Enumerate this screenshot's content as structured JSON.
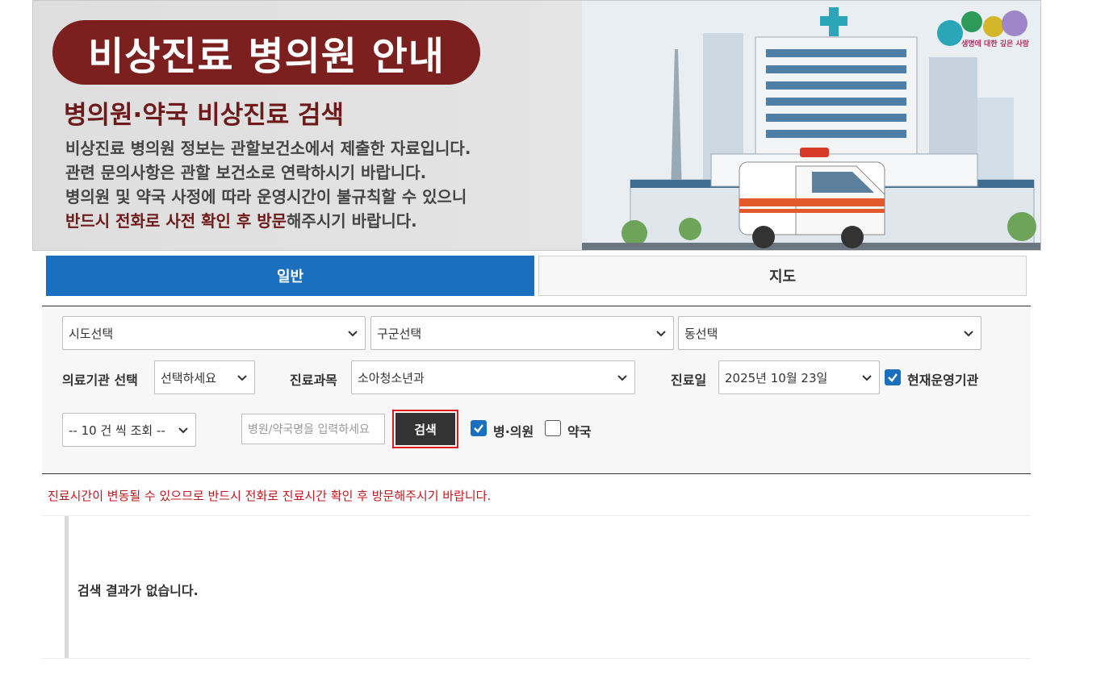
{
  "banner": {
    "title": "비상진료 병의원 안내",
    "subtitle": "병의원·약국 비상진료 검색",
    "lines": [
      "비상진료 병의원 정보는 관할보건소에서 제출한 자료입니다.",
      "관련 문의사항은 관할 보건소로 연락하시기 바랍니다.",
      "병의원 및 약국 사정에 따라 운영시간이 불규칙할 수 있으니"
    ],
    "last_line_emphasis": "반드시 전화로 사전 확인 후 방문",
    "last_line_rest": "해주시기 바랍니다.",
    "logo_caption": "생명에 대한 깊은 사랑",
    "colors": {
      "title_bg": "#7b1f1f",
      "accent_text": "#6e1a1a"
    }
  },
  "tabs": [
    {
      "label": "일반",
      "active": true
    },
    {
      "label": "지도",
      "active": false
    }
  ],
  "filters": {
    "sido": "시도선택",
    "gugun": "구군선택",
    "dong": "동선택",
    "institution_label": "의료기관 선택",
    "institution_value": "선택하세요",
    "department_label": "진료과목",
    "department_value": "소아청소년과",
    "date_label": "진료일",
    "date_value": "2025년 10월 23일",
    "operating_now_label": "현재운영기관",
    "operating_now_checked": true,
    "page_size": "-- 10 건 씩 조회 --",
    "name_placeholder": "병원/약국명을 입력하세요",
    "search_label": "검색",
    "hospital_label": "병·의원",
    "hospital_checked": true,
    "pharmacy_label": "약국",
    "pharmacy_checked": false
  },
  "notice": "진료시간이 변동될 수 있으므로 반드시 전화로 진료시간 확인 후 방문해주시기 바랍니다.",
  "result_message": "검색 결과가 없습니다.",
  "colors": {
    "primary": "#1a6fbf",
    "notice": "#c4161c",
    "button": "#333333",
    "highlight": "#e0191c"
  }
}
